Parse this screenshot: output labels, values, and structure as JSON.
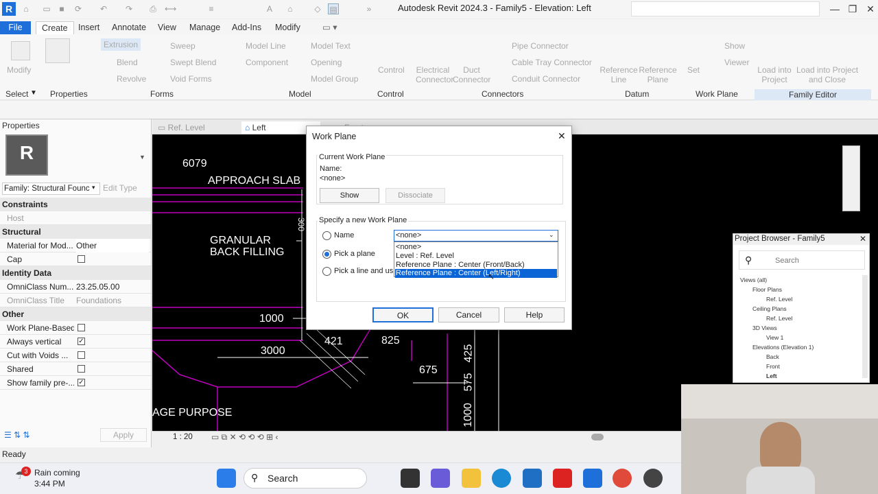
{
  "app": {
    "title": "Autodesk Revit 2024.3 - Family5 - Elevation: Left",
    "logo": "R"
  },
  "menu_tabs": [
    "File",
    "Create",
    "Insert",
    "Annotate",
    "View",
    "Manage",
    "Add-Ins",
    "Modify"
  ],
  "ribbon": {
    "select": [
      "Modify",
      "Select"
    ],
    "properties": "Properties",
    "forms": [
      "Extrusion",
      "Sweep",
      "Blend",
      "Swept Blend",
      "Revolve",
      "Void Forms"
    ],
    "forms_label": "Forms",
    "model": [
      "Model Line",
      "Model Text",
      "Component",
      "Opening",
      "Model Group"
    ],
    "model_label": "Model",
    "control": "Control",
    "control_label": "Control",
    "connectors": [
      "Electrical Connector",
      "Duct Connector",
      "Pipe Connector",
      "Cable Tray Connector",
      "Conduit Connector"
    ],
    "connectors_label": "Connectors",
    "datum": [
      "Reference Line",
      "Reference Plane"
    ],
    "datum_label": "Datum",
    "workplane": [
      "Set",
      "Show",
      "Viewer"
    ],
    "workplane_label": "Work Plane",
    "family_editor": [
      "Load into Project",
      "Load into Project and Close"
    ],
    "family_editor_label": "Family Editor"
  },
  "properties": {
    "title": "Properties",
    "family": "Family: Structural Founc",
    "edit_type": "Edit Type",
    "sections": {
      "constraints": "Constraints",
      "structural": "Structural",
      "identity": "Identity Data",
      "other": "Other"
    },
    "rows": {
      "host": "Host",
      "material_key": "Material for Mod...",
      "material_val": "Other",
      "cap": "Cap",
      "omni_num_key": "OmniClass Num...",
      "omni_num_val": "23.25.05.00",
      "omni_title_key": "OmniClass Title",
      "omni_title_val": "Foundations",
      "wp_based": "Work Plane-Based",
      "vertical": "Always vertical",
      "cut_voids": "Cut with Voids ...",
      "shared": "Shared",
      "show_family": "Show family pre-..."
    },
    "apply": "Apply"
  },
  "view_tabs": [
    "Ref. Level",
    "Left",
    "Front"
  ],
  "canvas_text": {
    "dim_6079": "6079",
    "approach": "APPROACH SLAB",
    "granular1": "GRANULAR",
    "granular2": "BACK FILLING",
    "d1000a": "1000",
    "d421": "421",
    "d825": "825",
    "d3000": "3000",
    "d675": "675",
    "d425": "425",
    "d575": "575",
    "d1000b": "1000",
    "d300": "300",
    "purpose": "AGE PURPOSE"
  },
  "view_control": {
    "scale": "1 : 20"
  },
  "status": "Ready",
  "dialog": {
    "title": "Work Plane",
    "current_group": "Current Work Plane",
    "name_label": "Name:",
    "name_value": "<none>",
    "show": "Show",
    "dissociate": "Dissociate",
    "specify_group": "Specify a new Work Plane",
    "opt_name": "Name",
    "opt_pick_plane": "Pick a plane",
    "opt_pick_line": "Pick a line and use",
    "combo_value": "<none>",
    "options": [
      "<none>",
      "Level : Ref. Level",
      "Reference Plane : Center (Front/Back)",
      "Reference Plane : Center (Left/Right)"
    ],
    "ok": "OK",
    "cancel": "Cancel",
    "help": "Help"
  },
  "project_browser": {
    "title": "Project Browser - Family5",
    "search_placeholder": "Search",
    "tree": [
      "Views (all)",
      "Floor Plans",
      "Ref. Level",
      "Ceiling Plans",
      "Ref. Level",
      "3D Views",
      "View 1",
      "Elevations (Elevation 1)",
      "Back",
      "Front",
      "Left"
    ]
  },
  "taskbar": {
    "weather_badge": "3",
    "weather": "Rain coming",
    "time": "3:44 PM",
    "search": "Search"
  },
  "colors": {
    "accent": "#1e6fd9",
    "cad_magenta": "#c000c0",
    "selection": "#0a64d6"
  }
}
